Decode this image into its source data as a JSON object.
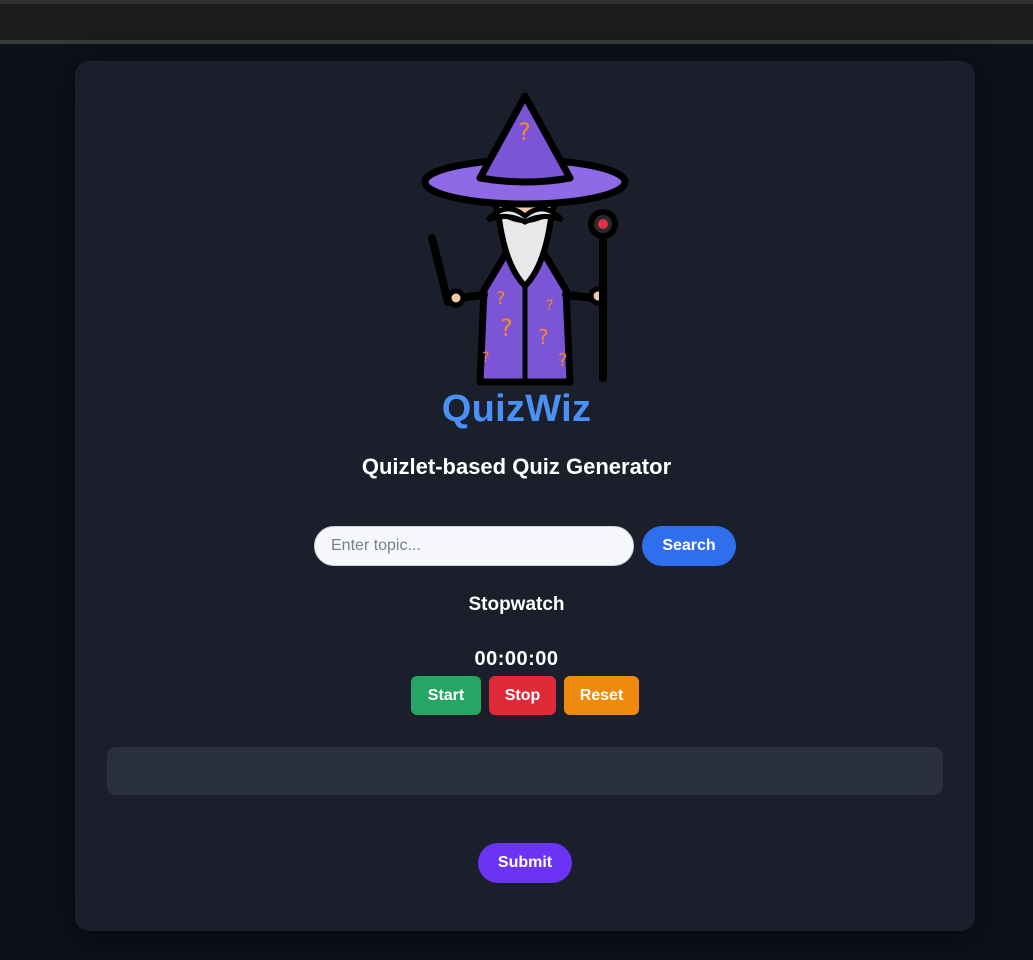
{
  "header": {
    "app_title": "QuizWiz",
    "subtitle": "Quizlet-based Quiz Generator",
    "logo_icon": "wizard-icon"
  },
  "search": {
    "placeholder": "Enter topic...",
    "value": "",
    "button_label": "Search"
  },
  "stopwatch": {
    "title": "Stopwatch",
    "time": "00:00:00",
    "start_label": "Start",
    "stop_label": "Stop",
    "reset_label": "Reset"
  },
  "result": {
    "text": ""
  },
  "submit": {
    "label": "Submit"
  },
  "colors": {
    "accent": "#4a90f5",
    "search_button": "#2f6fed",
    "start": "#27a565",
    "stop": "#e02a3a",
    "reset": "#f08a0c",
    "submit": "#6b34f5",
    "card": "#1a1f2b",
    "background": "#0d111b"
  }
}
